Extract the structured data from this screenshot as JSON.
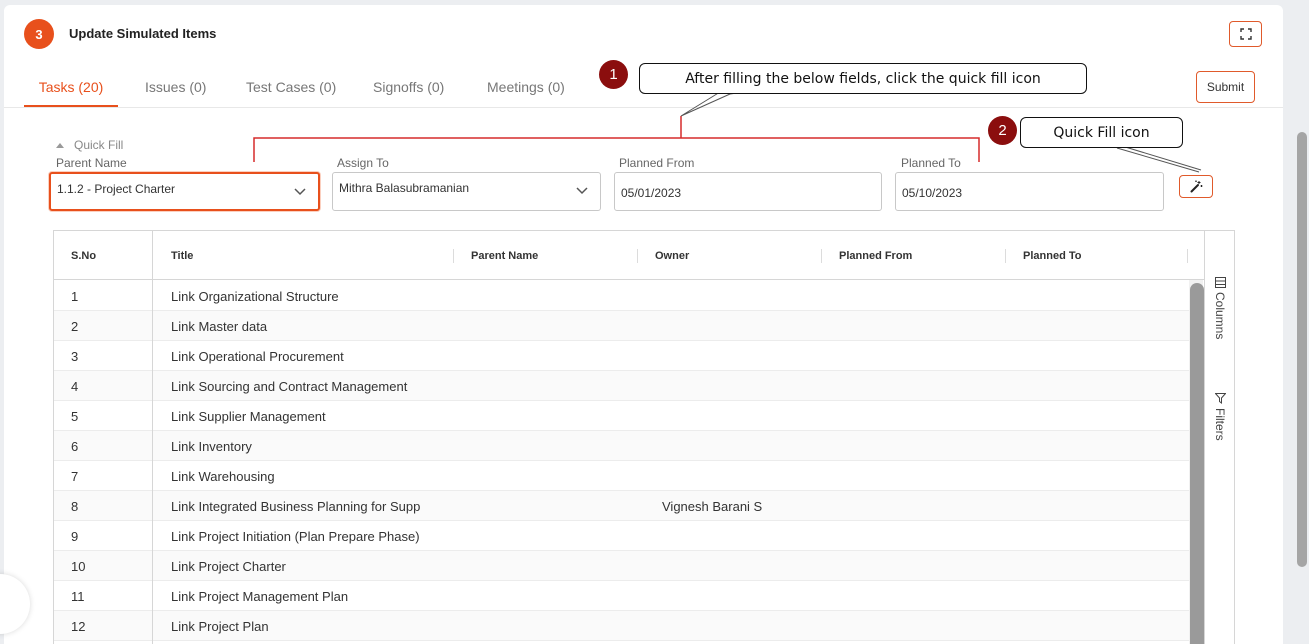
{
  "header": {
    "step_number": "3",
    "title": "Update Simulated Items",
    "submit_label": "Submit"
  },
  "tabs": [
    {
      "label": "Tasks (20)",
      "active": true
    },
    {
      "label": "Issues (0)",
      "active": false
    },
    {
      "label": "Test Cases (0)",
      "active": false
    },
    {
      "label": "Signoffs (0)",
      "active": false
    },
    {
      "label": "Meetings (0)",
      "active": false
    }
  ],
  "quick_fill": {
    "toggle_label": "Quick Fill",
    "parent_name": {
      "label": "Parent Name",
      "value": "1.1.2 - Project Charter"
    },
    "assign_to": {
      "label": "Assign To",
      "value": "Mithra Balasubramanian"
    },
    "planned_from": {
      "label": "Planned From",
      "value": "05/01/2023"
    },
    "planned_to": {
      "label": "Planned To",
      "value": "05/10/2023"
    }
  },
  "grid": {
    "columns": [
      "S.No",
      "Title",
      "Parent Name",
      "Owner",
      "Planned From",
      "Planned To"
    ],
    "rows": [
      {
        "sno": "1",
        "title": "Link Organizational Structure",
        "owner": ""
      },
      {
        "sno": "2",
        "title": "Link Master data",
        "owner": ""
      },
      {
        "sno": "3",
        "title": "Link Operational Procurement",
        "owner": ""
      },
      {
        "sno": "4",
        "title": "Link Sourcing and Contract Management",
        "owner": ""
      },
      {
        "sno": "5",
        "title": "Link Supplier Management",
        "owner": ""
      },
      {
        "sno": "6",
        "title": "Link Inventory",
        "owner": ""
      },
      {
        "sno": "7",
        "title": "Link Warehousing",
        "owner": ""
      },
      {
        "sno": "8",
        "title": "Link Integrated Business Planning for Supp",
        "owner": "Vignesh Barani S"
      },
      {
        "sno": "9",
        "title": "Link Project Initiation (Plan Prepare Phase)",
        "owner": ""
      },
      {
        "sno": "10",
        "title": "Link Project Charter",
        "owner": ""
      },
      {
        "sno": "11",
        "title": "Link Project Management Plan",
        "owner": ""
      },
      {
        "sno": "12",
        "title": "Link Project Plan",
        "owner": ""
      }
    ],
    "side_columns_label": "Columns",
    "side_filters_label": "Filters"
  },
  "annotations": {
    "step1_number": "1",
    "step1_text": "After filling the below fields, click the quick fill icon",
    "step2_number": "2",
    "step2_text": "Quick Fill icon"
  },
  "colors": {
    "accent": "#e8501c",
    "annotation_circle": "#8b0e0e",
    "annotation_line": "#d62b2b"
  }
}
